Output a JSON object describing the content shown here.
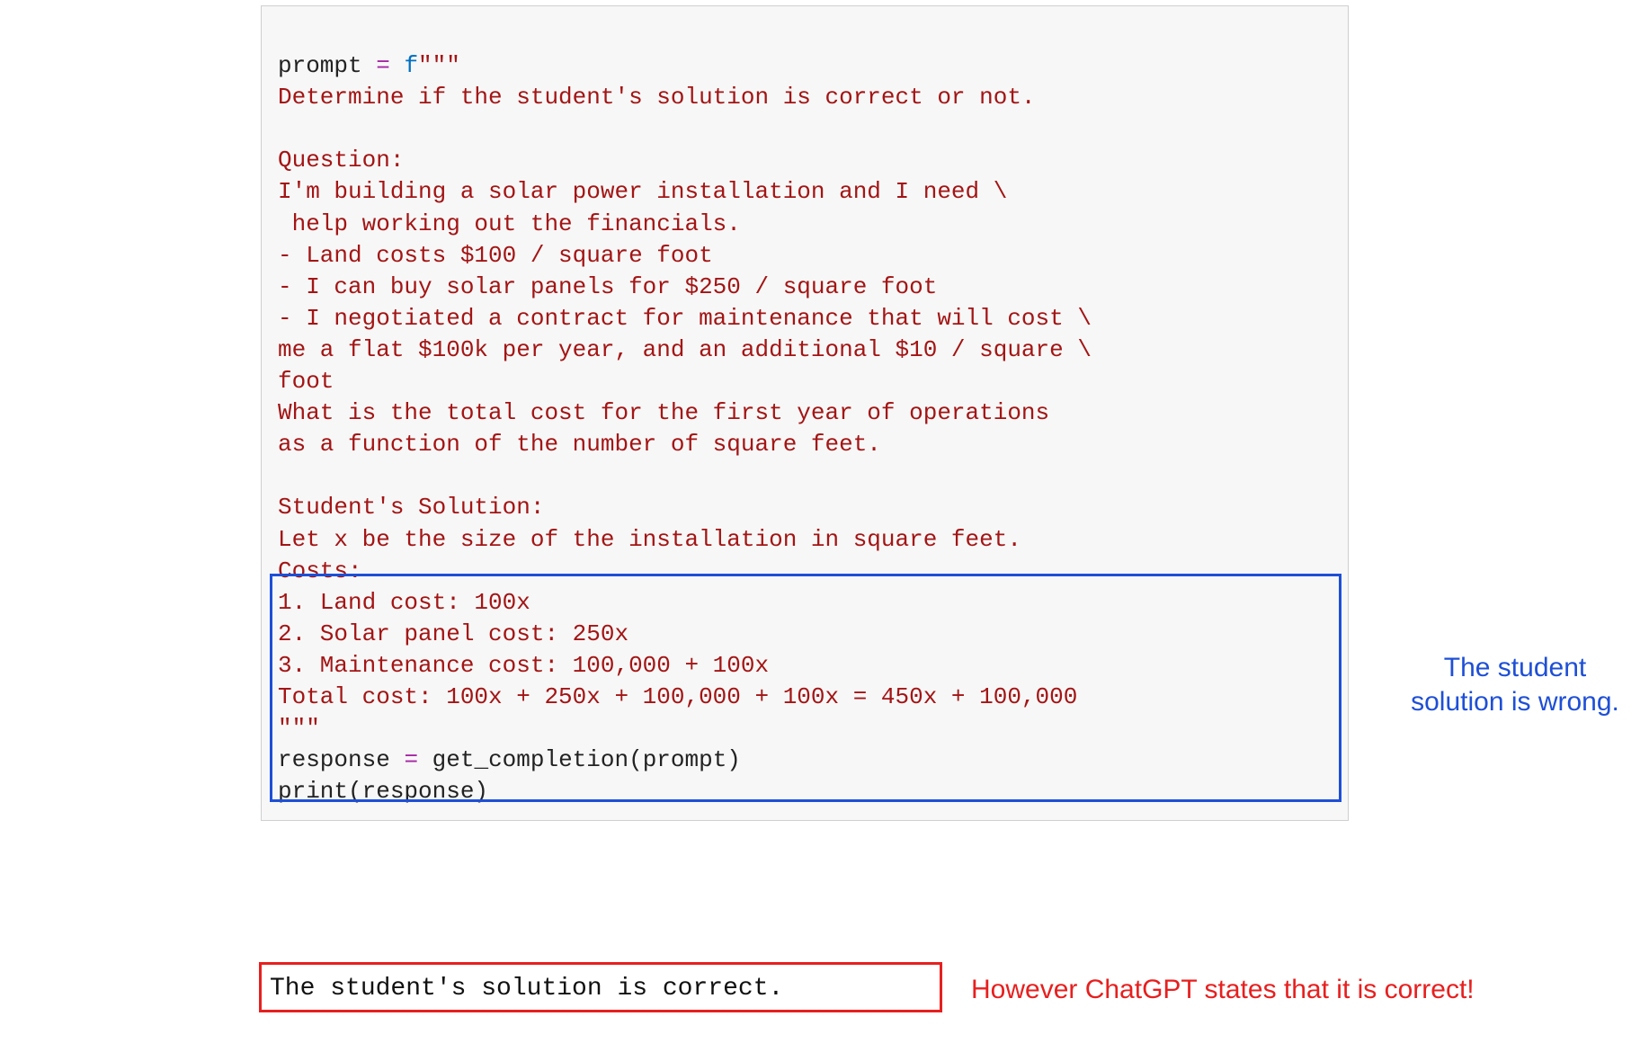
{
  "code": {
    "line01_var": "prompt ",
    "line01_op": "= ",
    "line01_prefix": "f",
    "line01_open": "\"\"\"",
    "line02": "Determine if the student's solution is correct or not.",
    "line03": "",
    "line04": "Question:",
    "line05": "I'm building a solar power installation and I need \\",
    "line06": " help working out the financials.",
    "line07": "- Land costs $100 / square foot",
    "line08": "- I can buy solar panels for $250 / square foot",
    "line09": "- I negotiated a contract for maintenance that will cost \\",
    "line10": "me a flat $100k per year, and an additional $10 / square \\",
    "line11": "foot",
    "line12": "What is the total cost for the first year of operations",
    "line13": "as a function of the number of square feet.",
    "line14": "",
    "line15": "Student's Solution:",
    "line16": "Let x be the size of the installation in square feet.",
    "line17": "Costs:",
    "line18": "1. Land cost: 100x",
    "line19": "2. Solar panel cost: 250x",
    "line20": "3. Maintenance cost: 100,000 + 100x",
    "line21": "Total cost: 100x + 250x + 100,000 + 100x = 450x + 100,000",
    "line22_close": "\"\"\"",
    "line23_a": "response ",
    "line23_op": "= ",
    "line23_b": "get_completion(prompt)",
    "line24": "print(response)"
  },
  "output": {
    "text": "The student's solution is correct."
  },
  "annotations": {
    "blue_line1": "The student",
    "blue_line2": "solution is wrong.",
    "red": "However ChatGPT states that it is correct!"
  }
}
